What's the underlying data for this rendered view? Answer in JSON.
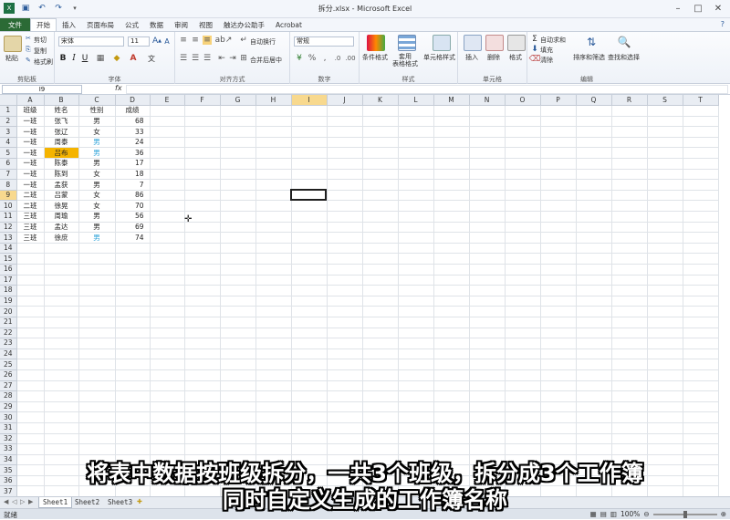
{
  "window": {
    "title": "拆分.xlsx - Microsoft Excel"
  },
  "menu": {
    "tabs": [
      "文件",
      "开始",
      "插入",
      "页面布局",
      "公式",
      "数据",
      "审阅",
      "视图",
      "触达办公助手",
      "Acrobat"
    ]
  },
  "ribbon": {
    "clipboard": {
      "paste": "粘贴",
      "cut": "剪切",
      "copy": "复制",
      "format_painter": "格式刷",
      "label": "剪贴板"
    },
    "font": {
      "name": "宋体",
      "size": "11",
      "label": "字体"
    },
    "alignment": {
      "wrap": "自动换行",
      "merge": "合并后居中",
      "label": "对齐方式"
    },
    "number": {
      "format": "常规",
      "label": "数字"
    },
    "styles": {
      "conditional": "条件格式",
      "table": "套用\n表格格式",
      "cell": "单元格样式",
      "label": "样式"
    },
    "cells": {
      "insert": "插入",
      "delete": "删除",
      "format": "格式",
      "label": "单元格"
    },
    "editing": {
      "autosum": "自动求和",
      "fill": "填充",
      "clear": "清除",
      "sort": "排序和筛选",
      "find": "查找和选择",
      "label": "编辑"
    }
  },
  "formula_bar": {
    "name_box": "I9",
    "fx": "fx",
    "content": ""
  },
  "sheet": {
    "columns": [
      "A",
      "B",
      "C",
      "D",
      "E",
      "F",
      "G",
      "H",
      "I",
      "J",
      "K",
      "L",
      "M",
      "N",
      "O",
      "P",
      "Q",
      "R",
      "S",
      "T"
    ],
    "selected_column": "I",
    "selected_row": 9,
    "row_count": 37,
    "rows": [
      [
        "班级",
        "姓名",
        "性别",
        "成绩"
      ],
      [
        "一班",
        "张飞",
        "男",
        "68"
      ],
      [
        "一班",
        "张辽",
        "女",
        "33"
      ],
      [
        "一班",
        "周泰",
        "男",
        "24"
      ],
      [
        "一班",
        "吕布",
        "男",
        "36"
      ],
      [
        "一班",
        "陈泰",
        "男",
        "17"
      ],
      [
        "一班",
        "陈到",
        "女",
        "18"
      ],
      [
        "一班",
        "孟获",
        "男",
        "7"
      ],
      [
        "二班",
        "吕蒙",
        "女",
        "86"
      ],
      [
        "二班",
        "徐晃",
        "女",
        "70"
      ],
      [
        "三班",
        "周瑜",
        "男",
        "56"
      ],
      [
        "三班",
        "孟达",
        "男",
        "69"
      ],
      [
        "三班",
        "徐庶",
        "男",
        "74"
      ]
    ],
    "highlight_cell": {
      "row": 5,
      "col": "B",
      "color": "#f5b400"
    },
    "blue_text_color": "#2aa1d8"
  },
  "sheet_tabs": [
    "Sheet1",
    "Sheet2",
    "Sheet3"
  ],
  "status": {
    "ready": "就绪",
    "zoom": "100%"
  },
  "subtitle": {
    "line1": "将表中数据按班级拆分，一共3个班级，拆分成3个工作簿",
    "line2": "同时自定义生成的工作簿名称"
  }
}
